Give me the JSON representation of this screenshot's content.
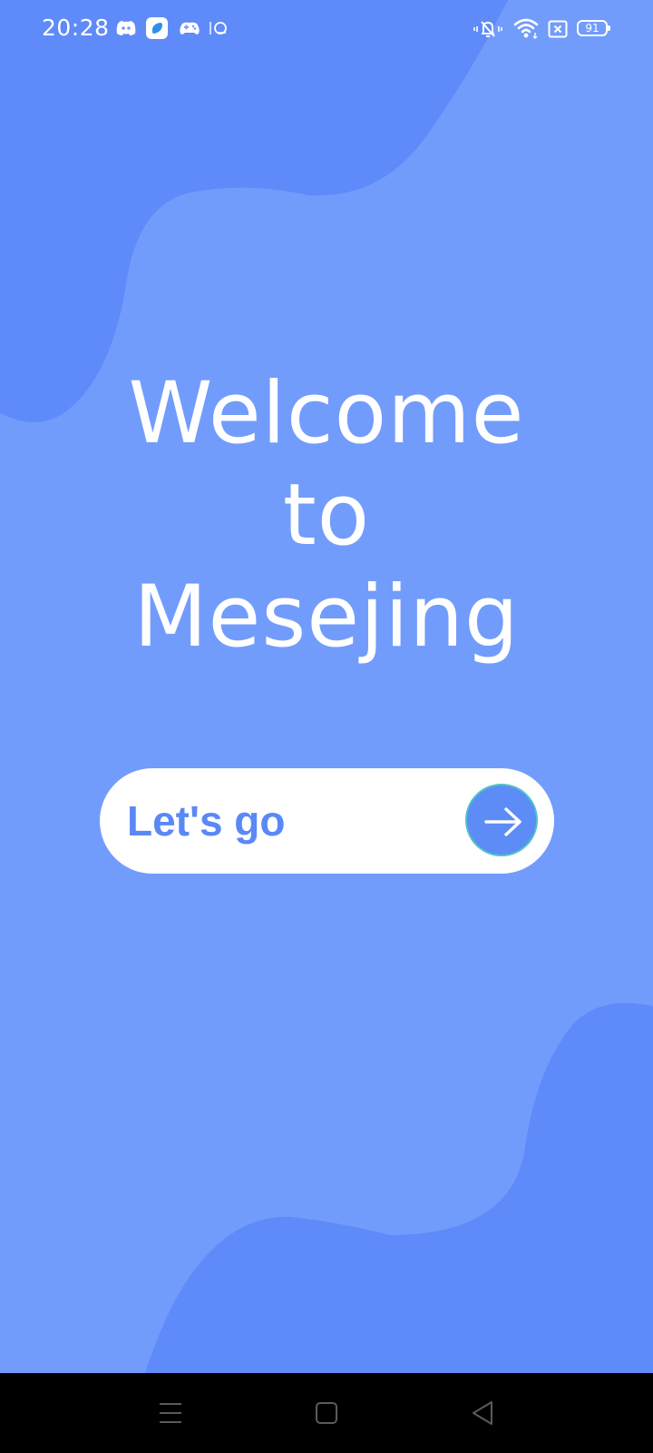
{
  "status_bar": {
    "time": "20:28",
    "battery_level": "91",
    "notification_icons": [
      "discord-icon",
      "shield-app-icon",
      "gamepad-icon",
      "sticker-icon"
    ],
    "system_icons": [
      "silent-mode-icon",
      "wifi-icon",
      "sim-disabled-icon",
      "battery-icon"
    ]
  },
  "welcome": {
    "line1": "Welcome",
    "line2": "to",
    "line3": "Mesejing"
  },
  "cta": {
    "label": "Let's go",
    "icon": "arrow-right-icon"
  },
  "nav_bar": {
    "buttons": [
      "recents-menu-icon",
      "home-icon",
      "back-icon"
    ]
  },
  "colors": {
    "background": "#729cfc",
    "blob": "#5f8af9",
    "cta_text": "#5a88f5",
    "cta_arrow_bg": "#5d8cf7",
    "nav_bar": "#000000"
  }
}
